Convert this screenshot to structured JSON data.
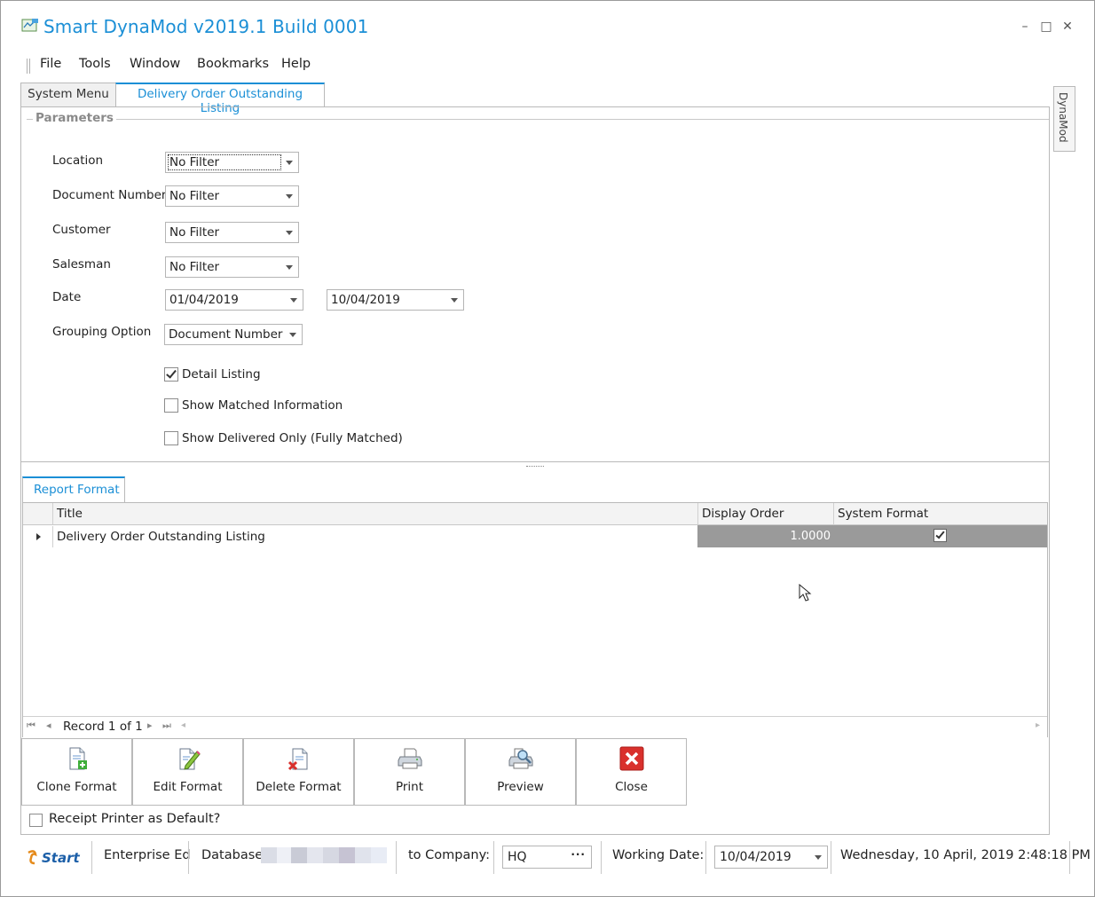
{
  "window": {
    "title": "Smart DynaMod v2019.1 Build 0001",
    "minimize": "–",
    "maximize": "□",
    "close": "✕"
  },
  "menu": [
    "File",
    "Tools",
    "Window",
    "Bookmarks",
    "Help"
  ],
  "doc_tabs": [
    "System Menu",
    "Delivery Order Outstanding Listing"
  ],
  "side_tab": "DynaMod",
  "parameters": {
    "title": "Parameters",
    "location": {
      "label": "Location",
      "value": "No Filter"
    },
    "document_number": {
      "label": "Document Number",
      "value": "No Filter"
    },
    "customer": {
      "label": "Customer",
      "value": "No Filter"
    },
    "salesman": {
      "label": "Salesman",
      "value": "No Filter"
    },
    "date": {
      "label": "Date",
      "from": "01/04/2019",
      "to": "10/04/2019"
    },
    "grouping": {
      "label": "Grouping Option",
      "value": "Document Number"
    },
    "checks": [
      {
        "label": "Detail Listing",
        "checked": true
      },
      {
        "label": "Show Matched Information",
        "checked": false
      },
      {
        "label": "Show Delivered Only (Fully Matched)",
        "checked": false
      }
    ]
  },
  "report_format": {
    "tab": "Report Format",
    "columns": [
      "Title",
      "Display Order",
      "System Format"
    ],
    "rows": [
      {
        "title": "Delivery Order Outstanding Listing",
        "display_order": "1.0000",
        "system_format": true
      }
    ],
    "record_text": "Record 1 of 1"
  },
  "buttons": [
    {
      "label": "Clone Format",
      "icon": "clone-format-icon"
    },
    {
      "label": "Edit Format",
      "icon": "edit-format-icon"
    },
    {
      "label": "Delete Format",
      "icon": "delete-format-icon"
    },
    {
      "label": "Print",
      "icon": "printer-icon"
    },
    {
      "label": "Preview",
      "icon": "preview-icon"
    },
    {
      "label": "Close",
      "icon": "close-x-icon"
    }
  ],
  "receipt_printer": {
    "label": "Receipt Printer as Default?",
    "checked": false
  },
  "status_bar": {
    "logo": "Start",
    "edition": "Enterprise Ed",
    "database_label": "Database:",
    "company_label": "to Company:",
    "company_value": "HQ",
    "working_date_label": "Working Date:",
    "working_date_value": "10/04/2019",
    "datetime": "Wednesday, 10 April, 2019 2:48:18 PM"
  },
  "colors": {
    "accent": "#1b8fd6",
    "selected_row": "#9a9a9a",
    "close_red": "#d9302c"
  }
}
